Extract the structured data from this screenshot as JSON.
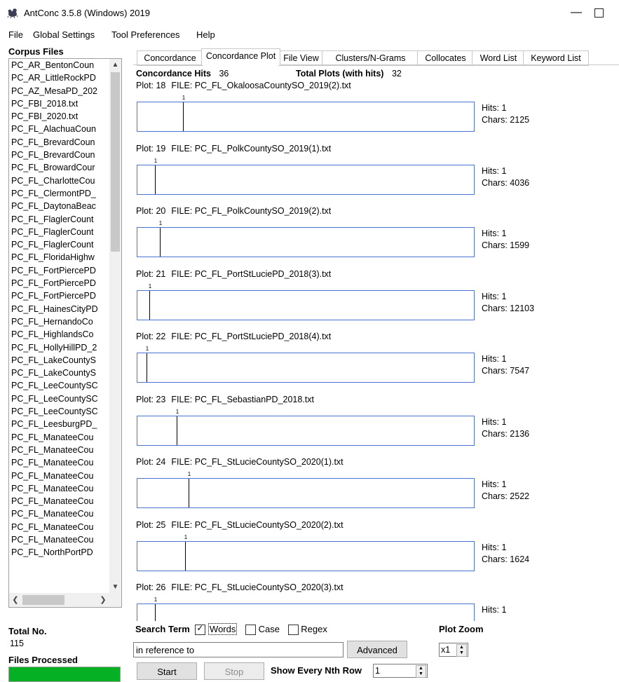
{
  "window": {
    "title": "AntConc 3.5.8 (Windows) 2019",
    "minimize_glyph": "—"
  },
  "menu": [
    "File",
    "Global Settings",
    "Tool Preferences",
    "Help"
  ],
  "sidebar": {
    "title": "Corpus Files",
    "files": [
      "PC_AR_BentonCoun",
      "PC_AR_LittleRockPD",
      "PC_AZ_MesaPD_202",
      "PC_FBI_2018.txt",
      "PC_FBI_2020.txt",
      "PC_FL_AlachuaCoun",
      "PC_FL_BrevardCoun",
      "PC_FL_BrevardCoun",
      "PC_FL_BrowardCour",
      "PC_FL_CharlotteCou",
      "PC_FL_ClermontPD_",
      "PC_FL_DaytonaBeac",
      "PC_FL_FlaglerCount",
      "PC_FL_FlaglerCount",
      "PC_FL_FlaglerCount",
      "PC_FL_FloridaHighw",
      "PC_FL_FortPiercePD",
      "PC_FL_FortPiercePD",
      "PC_FL_FortPiercePD",
      "PC_FL_HainesCityPD",
      "PC_FL_HernandoCo",
      "PC_FL_HighlandsCo",
      "PC_FL_HollyHillPD_2",
      "PC_FL_LakeCountyS",
      "PC_FL_LakeCountyS",
      "PC_FL_LeeCountySC",
      "PC_FL_LeeCountySC",
      "PC_FL_LeeCountySC",
      "PC_FL_LeesburgPD_",
      "PC_FL_ManateeCou",
      "PC_FL_ManateeCou",
      "PC_FL_ManateeCou",
      "PC_FL_ManateeCou",
      "PC_FL_ManateeCou",
      "PC_FL_ManateeCou",
      "PC_FL_ManateeCou",
      "PC_FL_ManateeCou",
      "PC_FL_ManateeCou",
      "PC_FL_NorthPortPD"
    ],
    "total_label": "Total No.",
    "total_value": "115",
    "files_processed_label": "Files Processed",
    "files_processed_fraction": 1.0
  },
  "tabs": [
    "Concordance",
    "Concordance Plot",
    "File View",
    "Clusters/N-Grams",
    "Collocates",
    "Word List",
    "Keyword List"
  ],
  "active_tab": "Concordance Plot",
  "summary": {
    "hits_label": "Concordance Hits",
    "hits_value": "36",
    "plots_label": "Total Plots (with hits)",
    "plots_value": "32"
  },
  "plots": [
    {
      "plot_label": "Plot: 18",
      "file": "FILE: PC_FL_OkaloosaCountySO_2019(2).txt",
      "marker": "1",
      "hit_position": 0.135,
      "hits": "Hits: 1",
      "chars": "Chars: 2125"
    },
    {
      "plot_label": "Plot: 19",
      "file": "FILE: PC_FL_PolkCountySO_2019(1).txt",
      "marker": "1",
      "hit_position": 0.052,
      "hits": "Hits: 1",
      "chars": "Chars: 4036"
    },
    {
      "plot_label": "Plot: 20",
      "file": "FILE: PC_FL_PolkCountySO_2019(2).txt",
      "marker": "1",
      "hit_position": 0.067,
      "hits": "Hits: 1",
      "chars": "Chars: 1599"
    },
    {
      "plot_label": "Plot: 21",
      "file": "FILE: PC_FL_PortStLuciePD_2018(3).txt",
      "marker": "1",
      "hit_position": 0.035,
      "hits": "Hits: 1",
      "chars": "Chars: 12103"
    },
    {
      "plot_label": "Plot: 22",
      "file": "FILE: PC_FL_PortStLuciePD_2018(4).txt",
      "marker": "1",
      "hit_position": 0.027,
      "hits": "Hits: 1",
      "chars": "Chars: 7547"
    },
    {
      "plot_label": "Plot: 23",
      "file": "FILE: PC_FL_SebastianPD_2018.txt",
      "marker": "1",
      "hit_position": 0.117,
      "hits": "Hits: 1",
      "chars": "Chars: 2136"
    },
    {
      "plot_label": "Plot: 24",
      "file": "FILE: PC_FL_StLucieCountySO_2020(1).txt",
      "marker": "1",
      "hit_position": 0.152,
      "hits": "Hits: 1",
      "chars": "Chars: 2522"
    },
    {
      "plot_label": "Plot: 25",
      "file": "FILE: PC_FL_StLucieCountySO_2020(2).txt",
      "marker": "1",
      "hit_position": 0.142,
      "hits": "Hits: 1",
      "chars": "Chars: 1624"
    },
    {
      "plot_label": "Plot: 26",
      "file": "FILE: PC_FL_StLucieCountySO_2020(3).txt",
      "marker": "1",
      "hit_position": 0.052,
      "hits": "Hits: 1",
      "chars": ""
    }
  ],
  "search": {
    "term_label": "Search Term",
    "words_label": "Words",
    "words_checked": true,
    "case_label": "Case",
    "case_checked": false,
    "regex_label": "Regex",
    "regex_checked": false,
    "value": "in reference to",
    "advanced_label": "Advanced",
    "start_label": "Start",
    "stop_label": "Stop",
    "nth_label": "Show Every Nth Row",
    "nth_value": "1",
    "zoom_label": "Plot Zoom",
    "zoom_value": "x1"
  },
  "colors": {
    "plot_border": "#4a73d3",
    "progress_fill": "#06b025"
  }
}
